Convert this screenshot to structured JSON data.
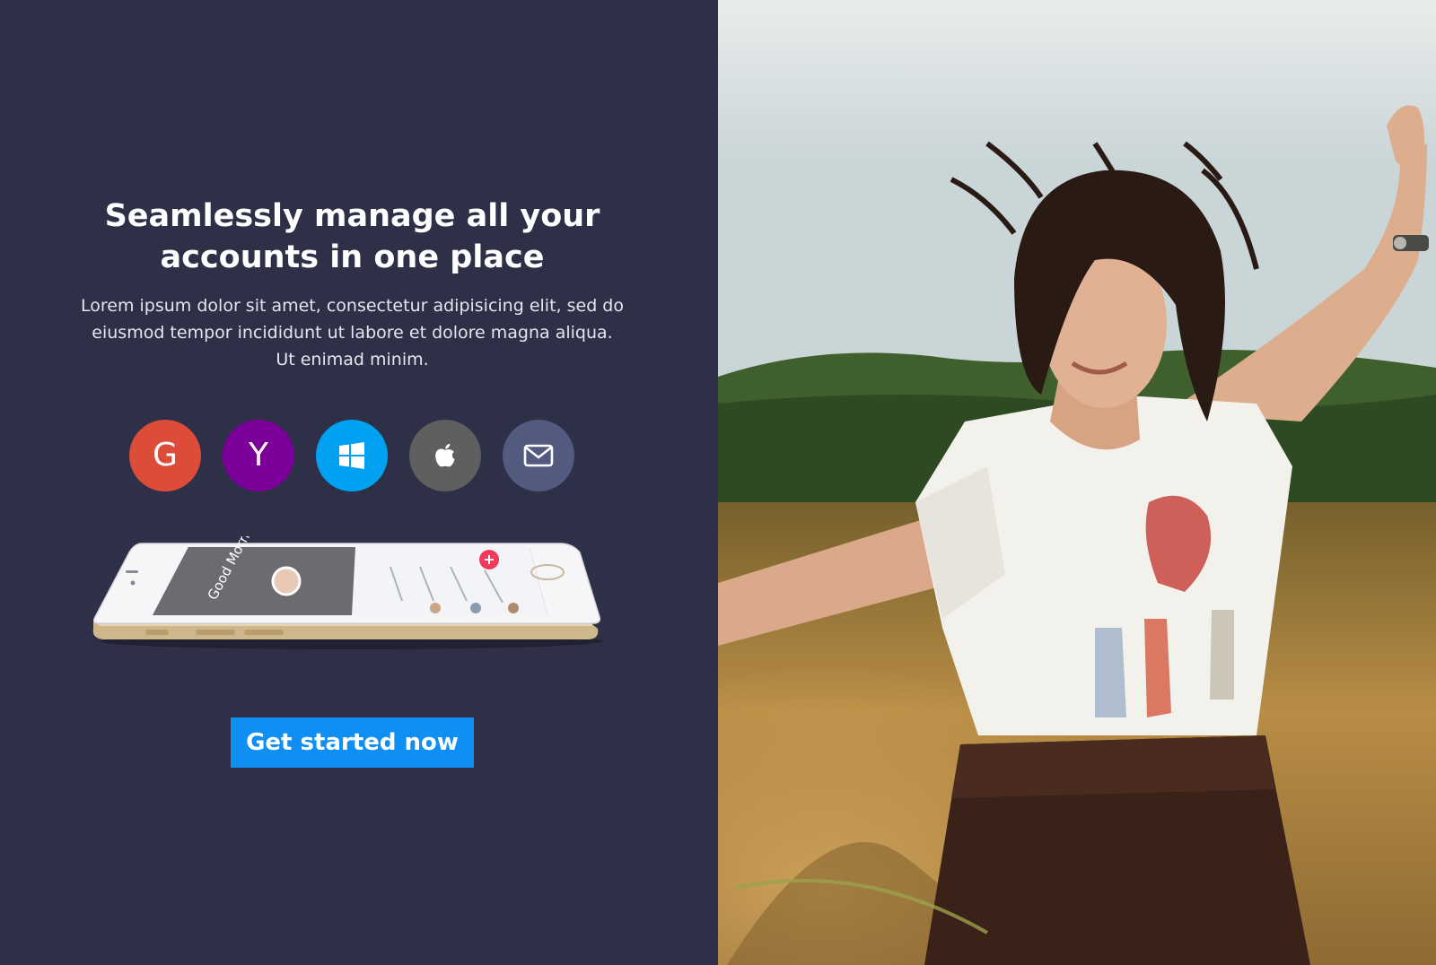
{
  "hero": {
    "headline_line1": "Seamlessly manage all your",
    "headline_line2": "accounts in one place",
    "subtext": "Lorem ipsum dolor sit amet, consectetur adipisicing elit, sed do eiusmod tempor incididunt ut labore et dolore magna aliqua. Ut enimad minim.",
    "cta_label": "Get started now"
  },
  "social_providers": [
    {
      "name": "google-icon",
      "glyph": "G",
      "color": "#dd4b39"
    },
    {
      "name": "yahoo-icon",
      "glyph": "Y",
      "color": "#7b0099"
    },
    {
      "name": "windows-icon",
      "glyph": "",
      "color": "#00a1f1"
    },
    {
      "name": "apple-icon",
      "glyph": "",
      "color": "#5f5f5f"
    },
    {
      "name": "email-icon",
      "glyph": "",
      "color": "#525a7f"
    }
  ],
  "phone_screen": {
    "greeting": "Good Morning"
  },
  "colors": {
    "left_bg": "#2d3047",
    "cta_bg": "#0f8ff3",
    "phone_gold": "#d9c39a"
  }
}
